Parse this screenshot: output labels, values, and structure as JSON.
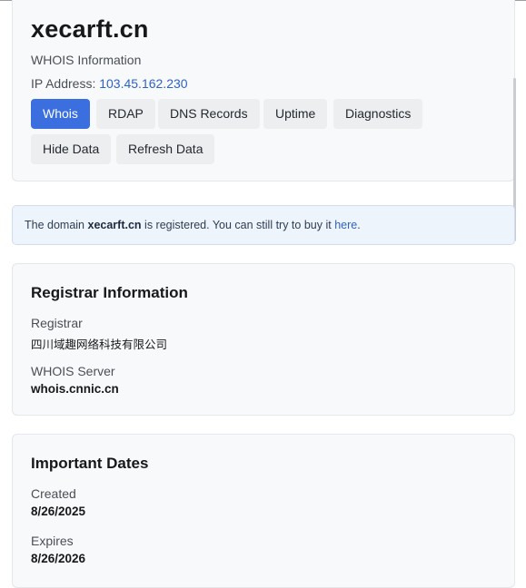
{
  "header": {
    "domain": "xecarft.cn",
    "subtitle": "WHOIS Information",
    "ip_label": "IP Address:",
    "ip_value": "103.45.162.230",
    "buttons": [
      "Whois",
      "RDAP",
      "DNS Records",
      "Uptime",
      "Diagnostics",
      "Hide Data",
      "Refresh Data"
    ],
    "active_button": "Whois"
  },
  "notice": {
    "prefix": "The domain",
    "domain": "xecarft.cn",
    "middle": "is registered. You can still try to buy it",
    "link": "here",
    "suffix": "."
  },
  "registrar": {
    "title": "Registrar Information",
    "registrar_label": "Registrar",
    "registrar_value": "四川域趣网络科技有限公司",
    "server_label": "WHOIS Server",
    "server_value": "whois.cnnic.cn"
  },
  "dates": {
    "title": "Important Dates",
    "created_label": "Created",
    "created_value": "8/26/2025",
    "expires_label": "Expires",
    "expires_value": "8/26/2026"
  },
  "colors": {
    "accent": "#3b6fe0",
    "link": "#2f62c8",
    "notice_bg": "#eef4fc"
  }
}
